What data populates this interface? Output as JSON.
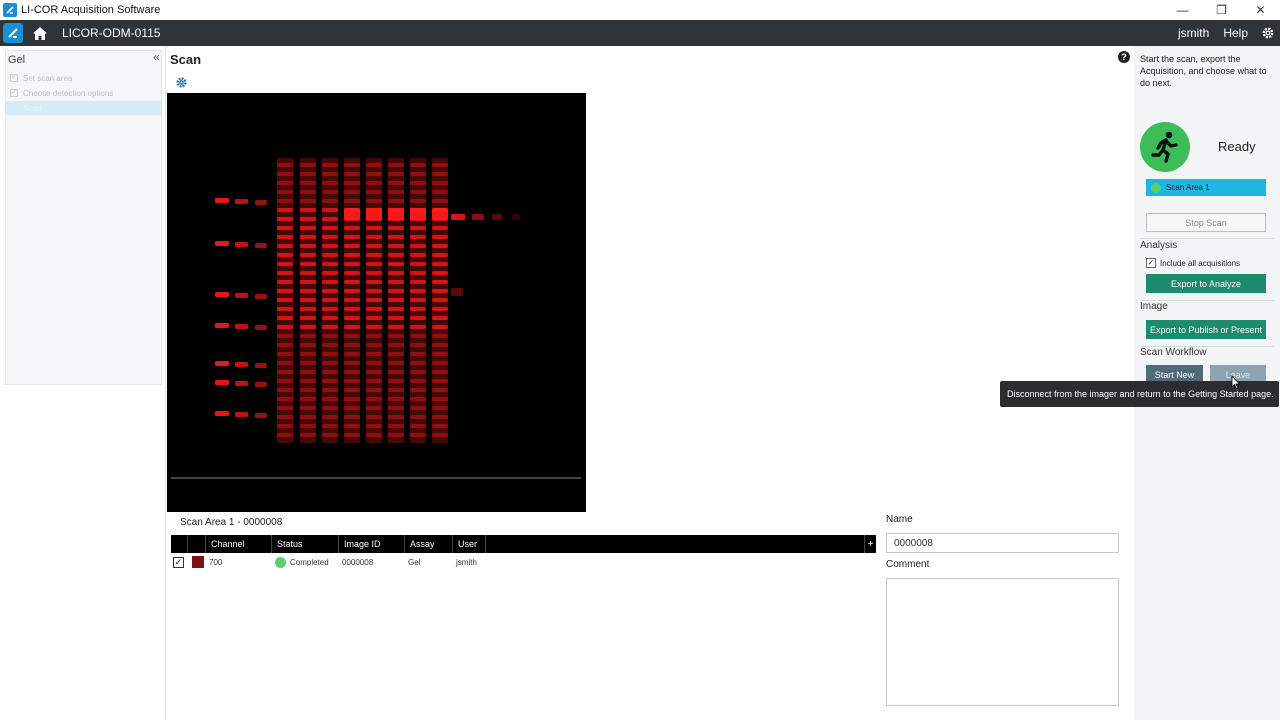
{
  "window": {
    "title": "LI-COR Acquisition Software",
    "controls": {
      "minimize": "—",
      "restore": "❐",
      "close": "✕"
    }
  },
  "header": {
    "device": "LICOR-ODM-0115",
    "user": "jsmith",
    "help": "Help"
  },
  "sidebar": {
    "collapse_glyph": "«",
    "title": "Gel",
    "steps": [
      {
        "label": "Set scan area",
        "checked": true
      },
      {
        "label": "Choose detection options",
        "checked": true
      },
      {
        "label": "Scan",
        "checked": false,
        "active": true
      }
    ]
  },
  "main": {
    "title": "Scan",
    "scan_area_label": "Scan Area 1 - 0000008",
    "grid": {
      "columns": [
        "Channel",
        "Status",
        "Image ID",
        "Assay",
        "User"
      ],
      "add_glyph": "+",
      "rows": [
        {
          "channel": "700",
          "status": "Completed",
          "image_id": "0000008",
          "assay": "Gel",
          "user": "jsmith",
          "swatch_color": "#7a0f17",
          "status_color": "#5bd06a"
        }
      ]
    },
    "name_label": "Name",
    "name_value": "0000008",
    "comment_label": "Comment"
  },
  "right_panel": {
    "intro": "Start the scan, export the Acquisition, and choose what to do next.",
    "status": "Ready",
    "scan_area_chip": "Scan Area 1",
    "stop_scan": "Stop Scan",
    "analysis_label": "Analysis",
    "include_all": "Include all acquisitions",
    "export_analyze": "Export to Analyze",
    "image_label": "Image",
    "export_publish": "Export to Publish or Present",
    "workflow_label": "Scan Workflow",
    "start_new": "Start New",
    "leave": "Leave"
  },
  "tooltip": "Disconnect from the imager and return to the Getting Started page.",
  "colors": {
    "header_bg": "#2f3436",
    "accent_blue": "#1a8fd6",
    "teal_button": "#1e8a6e",
    "chip_cyan": "#1fb6e2",
    "ready_green": "#3dbd57",
    "band_red": "#ff1a1a"
  },
  "icons": [
    "app-logo-icon",
    "home-icon",
    "gear-icon",
    "help-icon",
    "running-person-icon",
    "collapse-icon",
    "cursor-icon"
  ]
}
